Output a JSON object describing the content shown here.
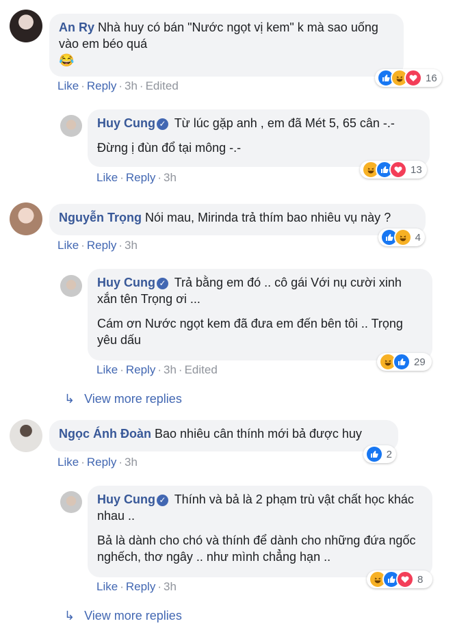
{
  "colors": {
    "link": "#4267b2",
    "name": "#385898",
    "bubble": "#f2f3f5",
    "meta": "#90949c",
    "like": "#1877f2",
    "love": "#f33e58",
    "haha": "#f7b125"
  },
  "actions": {
    "like": "Like",
    "reply": "Reply",
    "edited": "Edited",
    "view_more": "View more replies"
  },
  "comments": [
    {
      "name": "An Ry",
      "text": "Nhà huy có bán \"Nước ngọt vị kem\" k mà sao uống vào em béo quá",
      "emoji": "😂",
      "time": "3h",
      "edited": true,
      "reactions": [
        "like",
        "haha",
        "love"
      ],
      "count": "16"
    },
    {
      "name": "Huy Cung",
      "verified": true,
      "paras": [
        "Từ lúc gặp anh , em đã Mét 5, 65 cân -.-",
        "Đừng ị đùn đổ tại mông -.-"
      ],
      "time": "3h",
      "reactions": [
        "haha",
        "like",
        "love"
      ],
      "count": "13"
    },
    {
      "name": "Nguyễn Trọng",
      "text": "Nói mau, Mirinda trả thím bao nhiêu vụ này ?",
      "time": "3h",
      "reactions": [
        "like",
        "haha"
      ],
      "count": "4"
    },
    {
      "name": "Huy Cung",
      "verified": true,
      "paras": [
        "Trả bằng em đó .. cô gái Với nụ cười xinh xắn tên Trọng ơi ...",
        "Cám ơn Nước ngọt kem đã đưa em đến bên tôi .. Trọng yêu dấu"
      ],
      "time": "3h",
      "edited": true,
      "reactions": [
        "haha",
        "like"
      ],
      "count": "29"
    },
    {
      "name": "Ngọc Ánh Đoàn",
      "text": "Bao nhiêu cân thính mới bả được huy",
      "time": "3h",
      "reactions": [
        "like"
      ],
      "count": "2"
    },
    {
      "name": "Huy Cung",
      "verified": true,
      "paras": [
        "Thính và bả là 2 phạm trù vật chất học khác nhau ..",
        "Bả là dành cho chó và thính để dành cho những đứa ngốc nghếch, thơ ngây .. như mình chẳng hạn .."
      ],
      "time": "3h",
      "reactions": [
        "haha",
        "like",
        "love"
      ],
      "count": "8"
    }
  ]
}
